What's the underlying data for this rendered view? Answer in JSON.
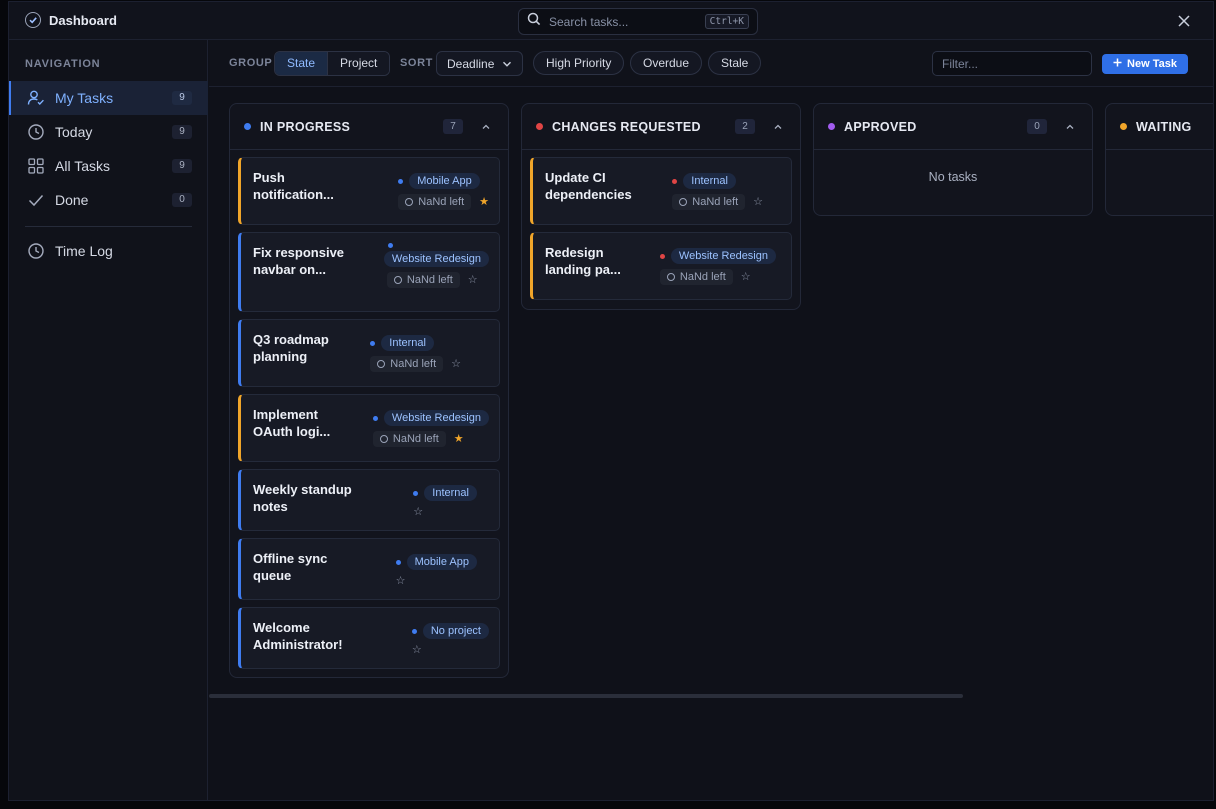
{
  "app": {
    "title": "Dashboard"
  },
  "search": {
    "placeholder": "Search tasks...",
    "shortcut": "Ctrl+K"
  },
  "sidebar": {
    "heading": "NAVIGATION",
    "items": [
      {
        "label": "My Tasks",
        "count": "9",
        "icon": "user-check-icon",
        "active": true
      },
      {
        "label": "Today",
        "count": "9",
        "icon": "clock-icon"
      },
      {
        "label": "All Tasks",
        "count": "9",
        "icon": "grid-icon"
      },
      {
        "label": "Done",
        "count": "0",
        "icon": "check-icon"
      },
      {
        "label": "Time Log",
        "icon": "clock-icon"
      }
    ]
  },
  "toolbar": {
    "group_label": "GROUP",
    "group_options": [
      "State",
      "Project"
    ],
    "group_selected": "State",
    "sort_label": "SORT",
    "sort_value": "Deadline",
    "chips": [
      "High Priority",
      "Overdue",
      "Stale"
    ],
    "filter_placeholder": "Filter...",
    "new_task_label": "New Task"
  },
  "colors": {
    "in_progress": "#3f7cf0",
    "changes_requested": "#e04545",
    "approved": "#a25cf0",
    "waiting": "#f0a52a",
    "accent": "#2f6fe6"
  },
  "columns": [
    {
      "title": "IN PROGRESS",
      "count": "7",
      "cards": [
        {
          "title": "Push notification...",
          "project": "Mobile App",
          "due": "NaNd left",
          "starred": true,
          "priority_color": "orange"
        },
        {
          "title": "Fix responsive navbar on...",
          "project": "Website Redesign",
          "due": "NaNd left",
          "starred": false,
          "priority_color": "blue"
        },
        {
          "title": "Q3 roadmap planning",
          "project": "Internal",
          "due": "NaNd left",
          "starred": false,
          "priority_color": "blue"
        },
        {
          "title": "Implement OAuth logi...",
          "project": "Website Redesign",
          "due": "NaNd left",
          "starred": true,
          "priority_color": "orange"
        },
        {
          "title": "Weekly standup notes",
          "project": "Internal",
          "starred": false,
          "priority_color": "blue"
        },
        {
          "title": "Offline sync queue",
          "project": "Mobile App",
          "starred": false,
          "priority_color": "blue"
        },
        {
          "title": "Welcome Administrator!",
          "project": "No project",
          "starred": false,
          "priority_color": "blue"
        }
      ]
    },
    {
      "title": "CHANGES REQUESTED",
      "count": "2",
      "cards": [
        {
          "title": "Update CI dependencies",
          "project": "Internal",
          "due": "NaNd left",
          "starred": false,
          "priority_color": "orange"
        },
        {
          "title": "Redesign landing pa...",
          "project": "Website Redesign",
          "due": "NaNd left",
          "starred": false,
          "priority_color": "orange"
        }
      ]
    },
    {
      "title": "APPROVED",
      "count": "0",
      "empty_text": "No tasks",
      "cards": []
    },
    {
      "title": "WAITING",
      "cards": []
    }
  ]
}
